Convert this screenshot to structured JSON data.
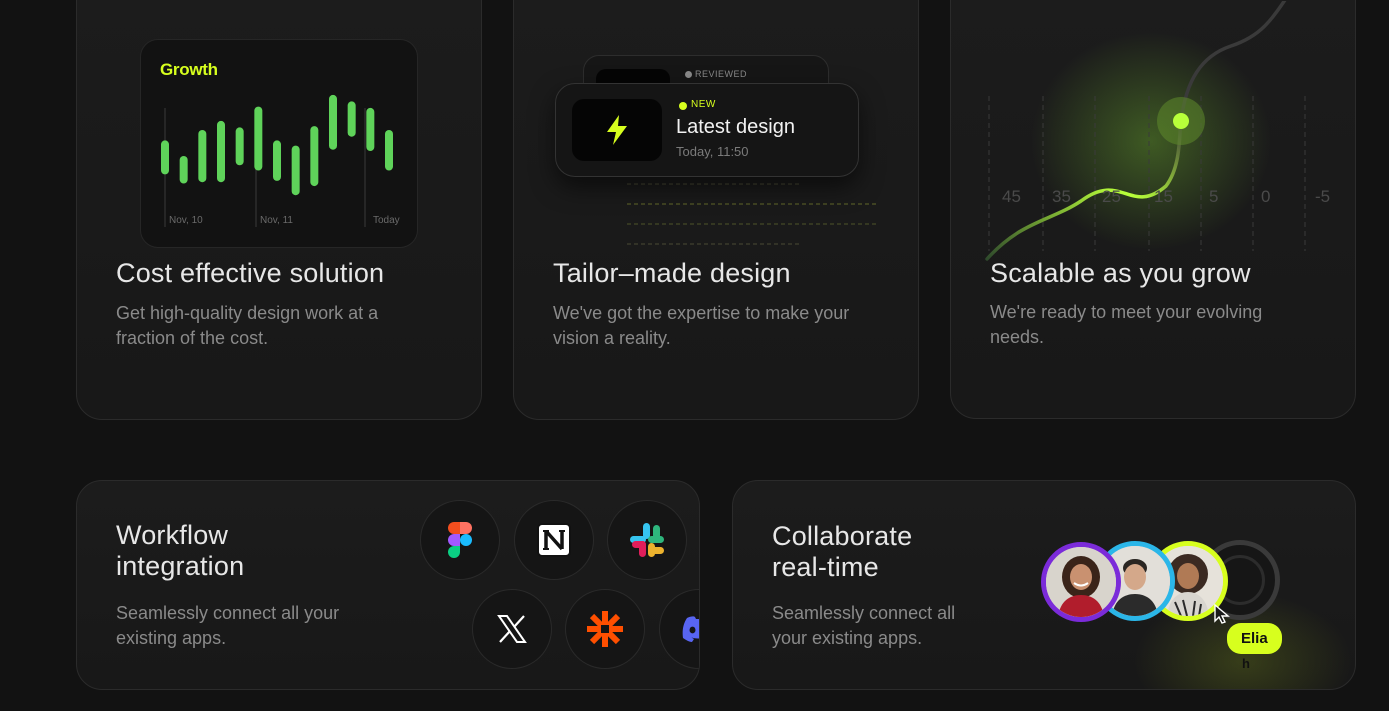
{
  "cards": {
    "cost": {
      "title": "Cost effective solution",
      "desc": "Get high-quality design work at a fraction of the cost.",
      "chart_title": "Growth",
      "chart_data": {
        "type": "bar",
        "title": "Growth",
        "x_tick_labels": [
          "Nov, 10",
          "Nov, 11",
          "Today"
        ],
        "bars": [
          {
            "low": 0.42,
            "high": 0.62
          },
          {
            "low": 0.35,
            "high": 0.5
          },
          {
            "low": 0.36,
            "high": 0.7
          },
          {
            "low": 0.36,
            "high": 0.77
          },
          {
            "low": 0.49,
            "high": 0.72
          },
          {
            "low": 0.45,
            "high": 0.88
          },
          {
            "low": 0.37,
            "high": 0.62
          },
          {
            "low": 0.26,
            "high": 0.58
          },
          {
            "low": 0.33,
            "high": 0.73
          },
          {
            "low": 0.61,
            "high": 0.97
          },
          {
            "low": 0.71,
            "high": 0.92
          },
          {
            "low": 0.6,
            "high": 0.87
          },
          {
            "low": 0.45,
            "high": 0.7
          }
        ],
        "color": "#5fd35a"
      }
    },
    "tailor": {
      "title": "Tailor–made design",
      "desc": "We've got the expertise to make your vision a reality.",
      "reviewed_label": "REVIEWED",
      "new_label": "NEW",
      "notif_title": "Latest design",
      "notif_time": "Today, 11:50"
    },
    "scalable": {
      "title": "Scalable as you grow",
      "desc": "We're ready to meet your evolving needs.",
      "scale_labels": [
        "45",
        "35",
        "25",
        "15",
        "5",
        "0",
        "-5"
      ]
    },
    "workflow": {
      "title_line1": "Workflow",
      "title_line2": "integration",
      "desc": "Seamlessly connect all your existing apps.",
      "apps": [
        "figma-icon",
        "notion-icon",
        "slack-icon",
        "x-icon",
        "zapier-icon",
        "discord-icon"
      ]
    },
    "collab": {
      "title_line1": "Collaborate",
      "title_line2": "real-time",
      "desc": "Seamlessly connect all your existing apps.",
      "cursor_name": "Elia",
      "cursor_name_overflow": "h"
    }
  },
  "colors": {
    "accent": "#d7ff1e",
    "bar_green": "#5fd35a",
    "avatar_purple": "#7b2bd9",
    "avatar_cyan": "#2bb6e8",
    "avatar_lime": "#d7ff1e"
  }
}
